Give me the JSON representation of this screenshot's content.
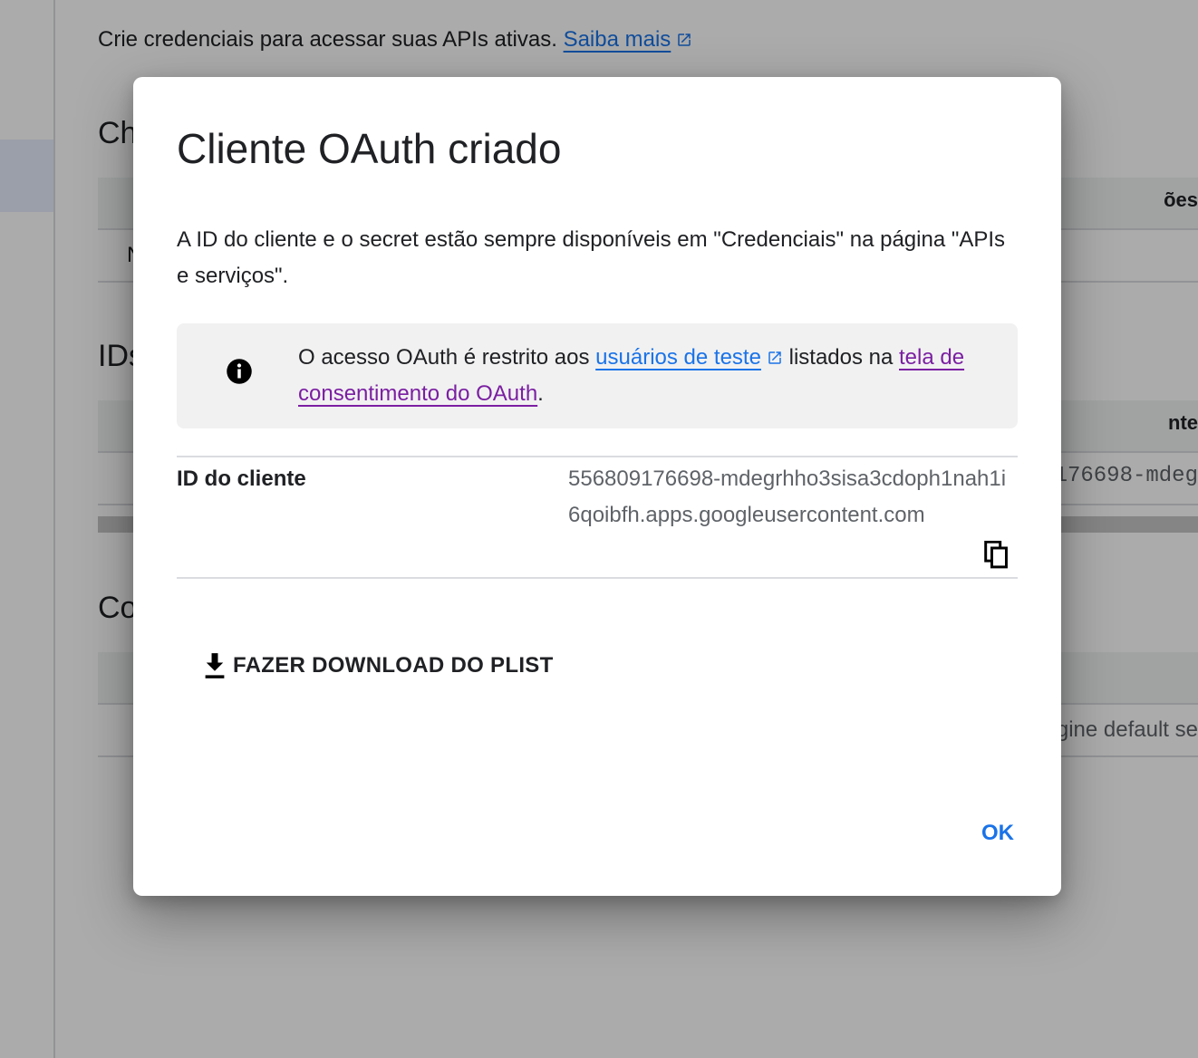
{
  "background": {
    "intro_text": "Crie credenciais para acessar suas APIs ativas.",
    "intro_link": "Saiba mais",
    "section_api_keys_fragment": "Ch",
    "api_keys_header_fragment": "ões",
    "api_keys_row_fragment": "N",
    "section_oauth_fragment": "IDs",
    "oauth_header_fragment": "nte",
    "oauth_row_fragment": "176698-mdeg",
    "section_sa_fragment": "Co",
    "sa_row_fragment": "gine default se"
  },
  "dialog": {
    "title": "Cliente OAuth criado",
    "description": "A ID do cliente e o secret estão sempre disponíveis em \"Credenciais\" na página \"APIs e serviços\".",
    "callout": {
      "text_before": "O acesso OAuth é restrito aos ",
      "link_test_users": "usuários de teste",
      "text_middle": " listados na ",
      "link_consent": "tela de consentimento do OAuth",
      "text_after": "."
    },
    "client_id_label": "ID do cliente",
    "client_id_value": "556809176698-mdegrhho3sisa3cdoph1nah1i6qoibfh.apps.googleusercontent.com",
    "download_label": "FAZER DOWNLOAD DO PLIST",
    "ok_label": "OK"
  },
  "icons": [
    "open-in-new-icon",
    "info-icon",
    "copy-icon",
    "download-icon"
  ],
  "colors": {
    "link": "#1a73e8",
    "visited_link": "#7b1fa2",
    "ok_button": "#1a73e8"
  }
}
